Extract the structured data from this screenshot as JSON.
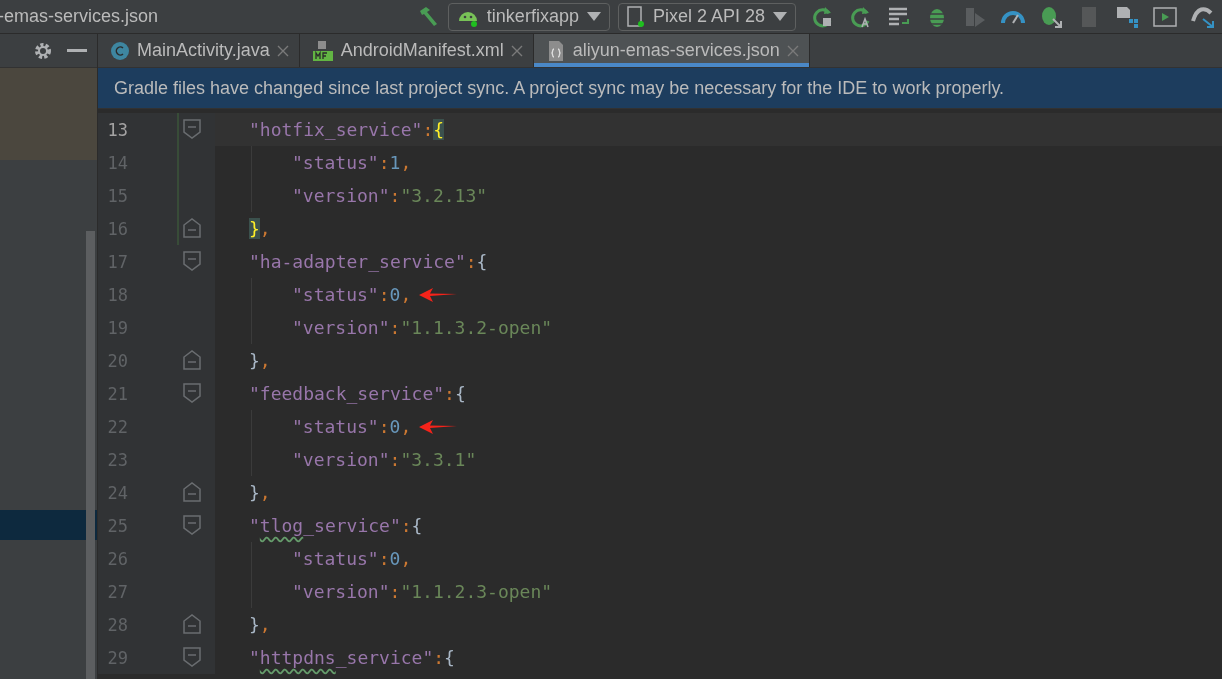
{
  "title": "-emas-services.json",
  "run_config": {
    "label": "tinkerfixapp"
  },
  "device": {
    "label": "Pixel 2 API 28"
  },
  "project_panel": {
    "selected_row": true
  },
  "tabs": [
    {
      "label": "MainActivity.java",
      "kind": "class",
      "selected": false
    },
    {
      "label": "AndroidManifest.xml",
      "kind": "manifest",
      "selected": false
    },
    {
      "label": "aliyun-emas-services.json",
      "kind": "json",
      "selected": true
    }
  ],
  "banner": "Gradle files have changed since last project sync. A project sync may be necessary for the IDE to work properly.",
  "lines": [
    {
      "number": "13",
      "kind": "open",
      "current": true,
      "changed": true,
      "marked": false,
      "tokens": [
        {
          "kind": "key",
          "text": "\"hotfix_service\""
        },
        {
          "kind": "punct",
          "text": ":"
        },
        {
          "kind": "match",
          "text": "{"
        }
      ]
    },
    {
      "number": "14",
      "kind": "entry",
      "current": false,
      "changed": true,
      "marked": false,
      "tokens": [
        {
          "kind": "key",
          "text": "\"status\""
        },
        {
          "kind": "punct",
          "text": ":"
        },
        {
          "kind": "number",
          "text": "1"
        },
        {
          "kind": "punct",
          "text": ","
        }
      ]
    },
    {
      "number": "15",
      "kind": "entry",
      "current": false,
      "changed": true,
      "marked": false,
      "tokens": [
        {
          "kind": "key",
          "text": "\"version\""
        },
        {
          "kind": "punct",
          "text": ":"
        },
        {
          "kind": "string",
          "text": "\"3.2.13\""
        }
      ]
    },
    {
      "number": "16",
      "kind": "close",
      "current": false,
      "changed": true,
      "marked": false,
      "tokens": [
        {
          "kind": "match",
          "text": "}"
        },
        {
          "kind": "punct",
          "text": ","
        }
      ]
    },
    {
      "number": "17",
      "kind": "open",
      "current": false,
      "changed": false,
      "marked": false,
      "tokens": [
        {
          "kind": "key",
          "text": "\"ha-adapter_service\""
        },
        {
          "kind": "punct",
          "text": ":"
        },
        {
          "kind": "brace",
          "text": "{"
        }
      ]
    },
    {
      "number": "18",
      "kind": "entry",
      "current": false,
      "changed": false,
      "marked": true,
      "tokens": [
        {
          "kind": "key",
          "text": "\"status\""
        },
        {
          "kind": "punct",
          "text": ":"
        },
        {
          "kind": "number",
          "text": "0"
        },
        {
          "kind": "punct",
          "text": ","
        }
      ]
    },
    {
      "number": "19",
      "kind": "entry",
      "current": false,
      "changed": false,
      "marked": false,
      "tokens": [
        {
          "kind": "key",
          "text": "\"version\""
        },
        {
          "kind": "punct",
          "text": ":"
        },
        {
          "kind": "string",
          "text": "\"1.1.3.2-open\""
        }
      ]
    },
    {
      "number": "20",
      "kind": "close",
      "current": false,
      "changed": false,
      "marked": false,
      "tokens": [
        {
          "kind": "brace",
          "text": "}"
        },
        {
          "kind": "punct",
          "text": ","
        }
      ]
    },
    {
      "number": "21",
      "kind": "open",
      "current": false,
      "changed": false,
      "marked": false,
      "tokens": [
        {
          "kind": "key",
          "text": "\"feedback_service\""
        },
        {
          "kind": "punct",
          "text": ":"
        },
        {
          "kind": "brace",
          "text": "{"
        }
      ]
    },
    {
      "number": "22",
      "kind": "entry",
      "current": false,
      "changed": false,
      "marked": true,
      "tokens": [
        {
          "kind": "key",
          "text": "\"status\""
        },
        {
          "kind": "punct",
          "text": ":"
        },
        {
          "kind": "number",
          "text": "0"
        },
        {
          "kind": "punct",
          "text": ","
        }
      ]
    },
    {
      "number": "23",
      "kind": "entry",
      "current": false,
      "changed": false,
      "marked": false,
      "tokens": [
        {
          "kind": "key",
          "text": "\"version\""
        },
        {
          "kind": "punct",
          "text": ":"
        },
        {
          "kind": "string",
          "text": "\"3.3.1\""
        }
      ]
    },
    {
      "number": "24",
      "kind": "close",
      "current": false,
      "changed": false,
      "marked": false,
      "tokens": [
        {
          "kind": "brace",
          "text": "}"
        },
        {
          "kind": "punct",
          "text": ","
        }
      ]
    },
    {
      "number": "25",
      "kind": "open",
      "current": false,
      "changed": false,
      "marked": false,
      "tokens": [
        {
          "kind": "key",
          "text": "\""
        },
        {
          "kind": "typo",
          "text": "tlog"
        },
        {
          "kind": "key",
          "text": "_service\""
        },
        {
          "kind": "punct",
          "text": ":"
        },
        {
          "kind": "brace",
          "text": "{"
        }
      ]
    },
    {
      "number": "26",
      "kind": "entry",
      "current": false,
      "changed": false,
      "marked": false,
      "tokens": [
        {
          "kind": "key",
          "text": "\"status\""
        },
        {
          "kind": "punct",
          "text": ":"
        },
        {
          "kind": "number",
          "text": "0"
        },
        {
          "kind": "punct",
          "text": ","
        }
      ]
    },
    {
      "number": "27",
      "kind": "entry",
      "current": false,
      "changed": false,
      "marked": false,
      "tokens": [
        {
          "kind": "key",
          "text": "\"version\""
        },
        {
          "kind": "punct",
          "text": ":"
        },
        {
          "kind": "string",
          "text": "\"1.1.2.3-open\""
        }
      ]
    },
    {
      "number": "28",
      "kind": "close",
      "current": false,
      "changed": false,
      "marked": false,
      "tokens": [
        {
          "kind": "brace",
          "text": "}"
        },
        {
          "kind": "punct",
          "text": ","
        }
      ]
    },
    {
      "number": "29",
      "kind": "open",
      "current": false,
      "changed": false,
      "marked": false,
      "tokens": [
        {
          "kind": "key",
          "text": "\""
        },
        {
          "kind": "typo",
          "text": "httpdns"
        },
        {
          "kind": "key",
          "text": "_service\""
        },
        {
          "kind": "punct",
          "text": ":"
        },
        {
          "kind": "brace",
          "text": "{"
        }
      ]
    }
  ]
}
